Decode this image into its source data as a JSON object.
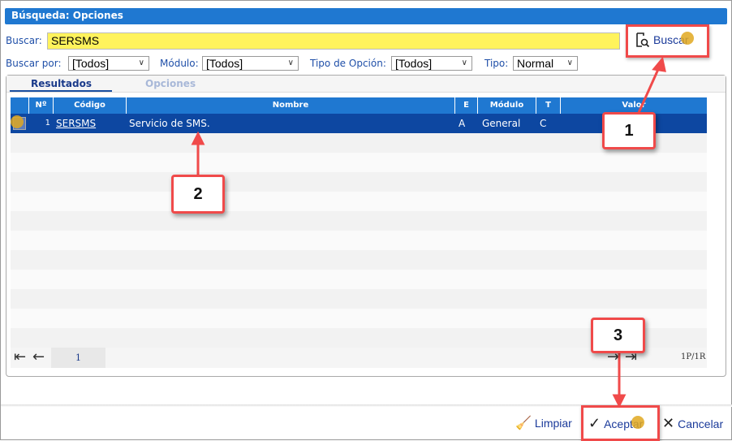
{
  "window": {
    "title": "Búsqueda: Opciones"
  },
  "search": {
    "label": "Buscar:",
    "value": "SERSMS",
    "button": "Buscar"
  },
  "filters": [
    {
      "label": "Buscar por:",
      "value": "[Todos]"
    },
    {
      "label": "Módulo:",
      "value": "[Todos]"
    },
    {
      "label": "Tipo de Opción:",
      "value": "[Todos]"
    },
    {
      "label": "Tipo:",
      "value": "Normal"
    }
  ],
  "tabs": [
    {
      "label": "Resultados",
      "active": true
    },
    {
      "label": "Opciones",
      "active": false
    }
  ],
  "grid": {
    "columns": [
      "Nº",
      "Código",
      "Nombre",
      "E",
      "Módulo",
      "T",
      "Valor"
    ],
    "rows": [
      {
        "n": "1",
        "codigo": "SERSMS",
        "nombre": "Servicio de SMS.",
        "e": "A",
        "modulo": "General",
        "t": "C",
        "valor": ""
      }
    ]
  },
  "pager": {
    "page": "1",
    "summary": "1P/1R"
  },
  "footer": {
    "clear": "Limpiar",
    "accept": "Aceptar",
    "cancel": "Cancelar"
  },
  "annotations": [
    "1",
    "2",
    "3"
  ],
  "colors": {
    "header": "#1f78d1",
    "selected_row": "#0d47a1",
    "search_bg": "#fff35c",
    "annotation": "#f04a4a"
  }
}
